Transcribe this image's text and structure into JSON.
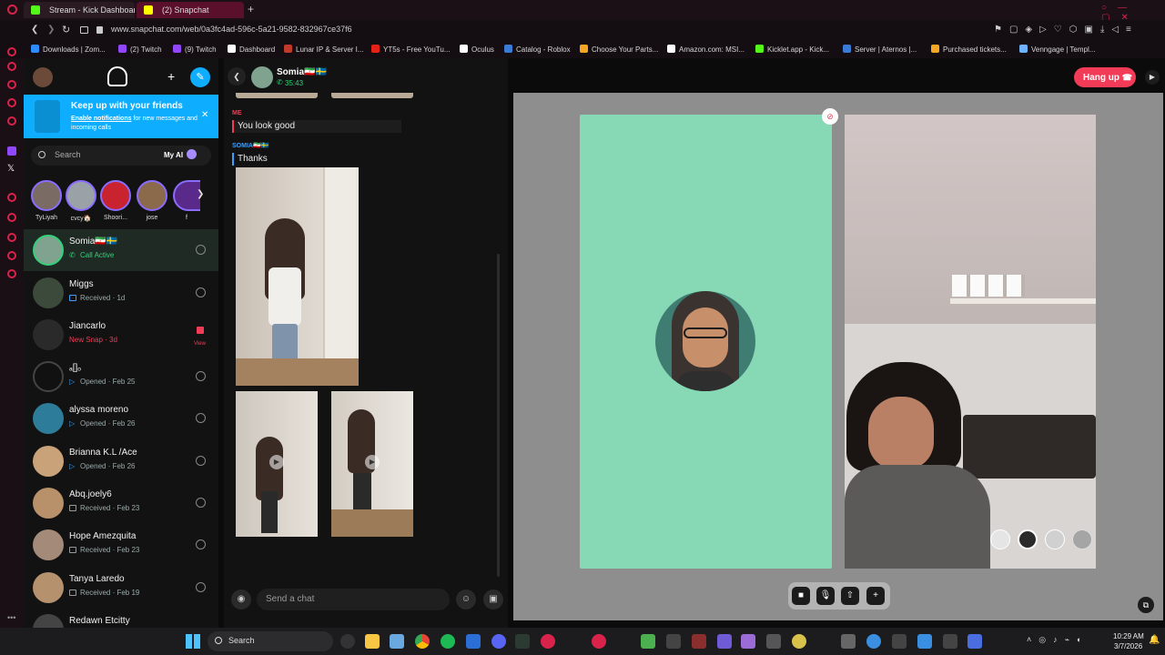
{
  "browser": {
    "tabs": [
      {
        "label": "Stream - Kick Dashboard",
        "color": "#53fc18"
      },
      {
        "label": "(2) Snapchat",
        "color": "#fffc00"
      }
    ],
    "url": "www.snapchat.com/web/0a3fc4ad-596c-5a21-9582-832967ce37f6",
    "bookmarks": [
      {
        "label": "Downloads | Zom...",
        "color": "#2d8cff"
      },
      {
        "label": "(2) Twitch",
        "color": "#9146ff"
      },
      {
        "label": "(9) Twitch",
        "color": "#9146ff"
      },
      {
        "label": "Dashboard",
        "color": "#ffffff"
      },
      {
        "label": "Lunar IP & Server I...",
        "color": "#c0392b"
      },
      {
        "label": "YT5s - Free YouTu...",
        "color": "#e62117"
      },
      {
        "label": "Oculus",
        "color": "#ffffff"
      },
      {
        "label": "Catalog - Roblox",
        "color": "#3a7bd5"
      },
      {
        "label": "Choose Your Parts...",
        "color": "#f5a623"
      },
      {
        "label": "Amazon.com: MSI...",
        "color": "#ffffff"
      },
      {
        "label": "Kicklet.app - Kick...",
        "color": "#53fc18"
      },
      {
        "label": "Server | Aternos |...",
        "color": "#3a7bd5"
      },
      {
        "label": "Purchased tickets...",
        "color": "#f5a623"
      },
      {
        "label": "Venngage | Templ...",
        "color": "#6fb3ff"
      }
    ]
  },
  "snap": {
    "banner": {
      "title": "Keep up with your friends",
      "body_link": "Enable notifications",
      "body_rest": "for new messages and incoming calls"
    },
    "search": {
      "placeholder": "Search",
      "my_ai": "My AI"
    },
    "stories": [
      "TyLiyah",
      "cvcy🏠",
      "Shoori...",
      "jose",
      "f"
    ],
    "chats": [
      {
        "name": "Somia🇮🇷🇸🇪",
        "status": "Call Active",
        "status_color": "#33d17a"
      },
      {
        "name": "Miggs",
        "status": "Received · 1d",
        "status_color": "#9aa0a6"
      },
      {
        "name": "Jiancarlo",
        "status": "New Snap · 3d",
        "status_color": "#f23c57",
        "action": "View"
      },
      {
        "name": "ₐ[]ₒ",
        "status": "Opened · Feb 25",
        "status_color": "#9aa0a6"
      },
      {
        "name": "alyssa moreno",
        "status": "Opened · Feb 26",
        "status_color": "#9aa0a6"
      },
      {
        "name": "Brianna K.L /Ace",
        "status": "Opened · Feb 26",
        "status_color": "#9aa0a6"
      },
      {
        "name": "Abq.joely6",
        "status": "Received · Feb 23",
        "status_color": "#9aa0a6"
      },
      {
        "name": "Hope Amezquita",
        "status": "Received · Feb 23",
        "status_color": "#9aa0a6"
      },
      {
        "name": "Tanya Laredo",
        "status": "Received · Feb 19",
        "status_color": "#9aa0a6"
      },
      {
        "name": "Redawn Etcitty",
        "status": "",
        "status_color": "#9aa0a6"
      }
    ],
    "conversation": {
      "header_name": "Somia🇮🇷🇸🇪",
      "call_timer": "35:43",
      "me_label": "ME",
      "me_message": "You look good",
      "them_label": "SOMIA🇮🇷🇸🇪",
      "them_message": "Thanks",
      "input_placeholder": "Send a chat"
    },
    "hang_up": "Hang up"
  },
  "taskbar": {
    "search": "Search",
    "time": "10:29 AM",
    "date": "3/7/2026"
  }
}
